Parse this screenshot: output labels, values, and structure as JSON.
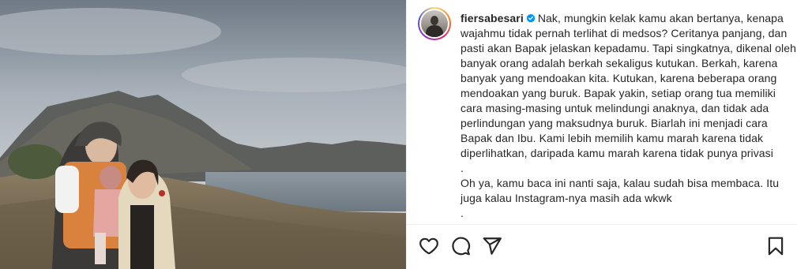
{
  "post": {
    "username": "fiersabesari",
    "caption": "Nak, mungkin kelak kamu akan bertanya, kenapa wajahmu tidak pernah terlihat di medsos? Ceritanya panjang, dan pasti akan Bapak jelaskan kepadamu. Tapi singkatnya, dikenal oleh banyak orang adalah berkah sekaligus kutukan. Berkah, karena banyak yang mendoakan kita. Kutukan, karena beberapa orang mendoakan yang buruk. Bapak yakin, setiap orang tua memiliki cara masing-masing untuk melindungi anaknya, dan tidak ada perlindungan yang maksudnya buruk. Biarlah ini menjadi cara Bapak dan Ibu. Kami lebih memilih kamu marah karena tidak diperlihatkan, daripada kamu marah karena tidak punya privasi\n.\nOh ya, kamu baca ini nanti saja, kalau sudah bisa membaca. Itu juga kalau Instagram-nya masih ada wkwk\n.",
    "verified": true
  },
  "icons": {
    "like": "heart-icon",
    "comment": "comment-icon",
    "share": "share-icon",
    "save": "bookmark-icon",
    "verified": "verified-badge-icon"
  },
  "colors": {
    "text": "#262626",
    "verified": "#0095f6",
    "border": "#efefef"
  }
}
